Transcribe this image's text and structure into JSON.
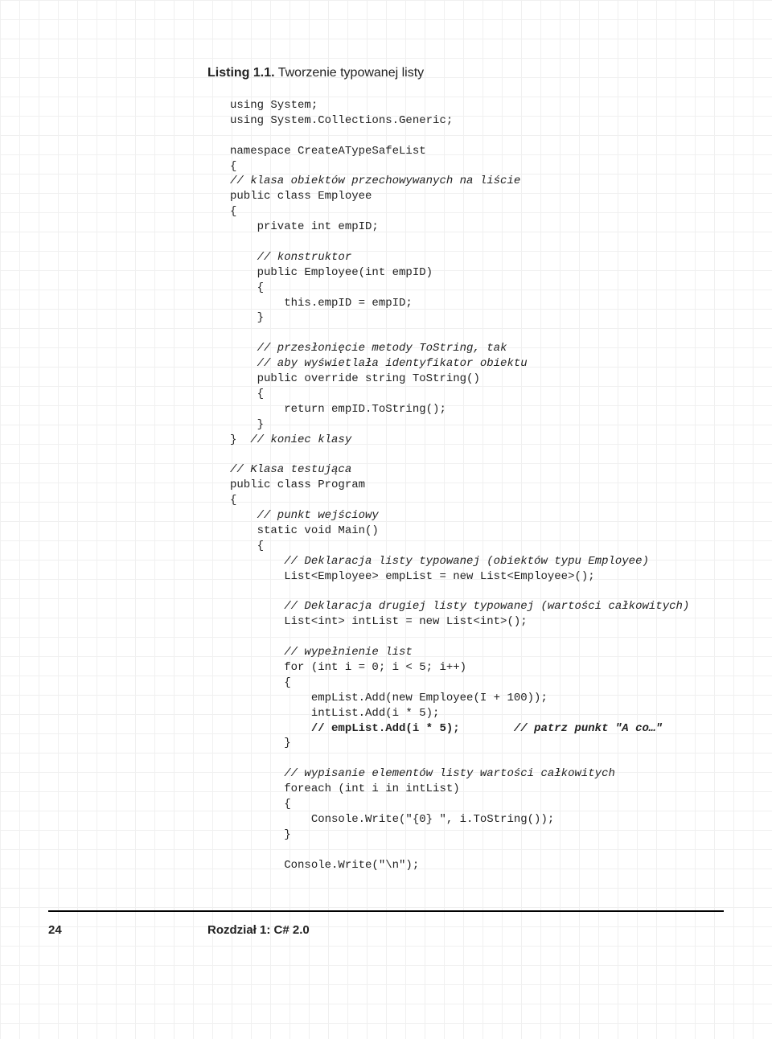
{
  "listing": {
    "number": "Listing 1.1.",
    "title": "Tworzenie typowanej listy"
  },
  "code": {
    "l00": "using System;",
    "l01": "using System.Collections.Generic;",
    "l02": "",
    "l03": "namespace CreateATypeSafeList",
    "l04": "{",
    "l05c": "// klasa obiektów przechowywanych na liście",
    "l06": "public class Employee",
    "l07": "{",
    "l08": "    private int empID;",
    "l09": "",
    "l10c": "    // konstruktor",
    "l11": "    public Employee(int empID)",
    "l12": "    {",
    "l13": "        this.empID = empID;",
    "l14": "    }",
    "l15": "",
    "l16c": "    // przesłonięcie metody ToString, tak",
    "l17c": "    // aby wyświetlała identyfikator obiektu",
    "l18": "    public override string ToString()",
    "l19": "    {",
    "l20": "        return empID.ToString();",
    "l21": "    }",
    "l22a": "}  ",
    "l22c": "// koniec klasy",
    "l23": "",
    "l24c": "// Klasa testująca",
    "l25": "public class Program",
    "l26": "{",
    "l27c": "    // punkt wejściowy",
    "l28": "    static void Main()",
    "l29": "    {",
    "l30c": "        // Deklaracja listy typowanej (obiektów typu Employee)",
    "l31": "        List<Employee> empList = new List<Employee>();",
    "l32": "",
    "l33c": "        // Deklaracja drugiej listy typowanej (wartości całkowitych)",
    "l34": "        List<int> intList = new List<int>();",
    "l35": "",
    "l36c": "        // wypełnienie list",
    "l37": "        for (int i = 0; i < 5; i++)",
    "l38": "        {",
    "l39": "            empList.Add(new Employee(I + 100));",
    "l40": "            intList.Add(i * 5);",
    "l41b": "            // empList.Add(i * 5);        ",
    "l41c": "// patrz punkt \"A co…\"",
    "l42": "        }",
    "l43": "",
    "l44c": "        // wypisanie elementów listy wartości całkowitych",
    "l45": "        foreach (int i in intList)",
    "l46": "        {",
    "l47": "            Console.Write(\"{0} \", i.ToString());",
    "l48": "        }",
    "l49": "",
    "l50": "        Console.Write(\"\\n\");"
  },
  "footer": {
    "page": "24",
    "chapter": "Rozdział 1: C# 2.0"
  }
}
